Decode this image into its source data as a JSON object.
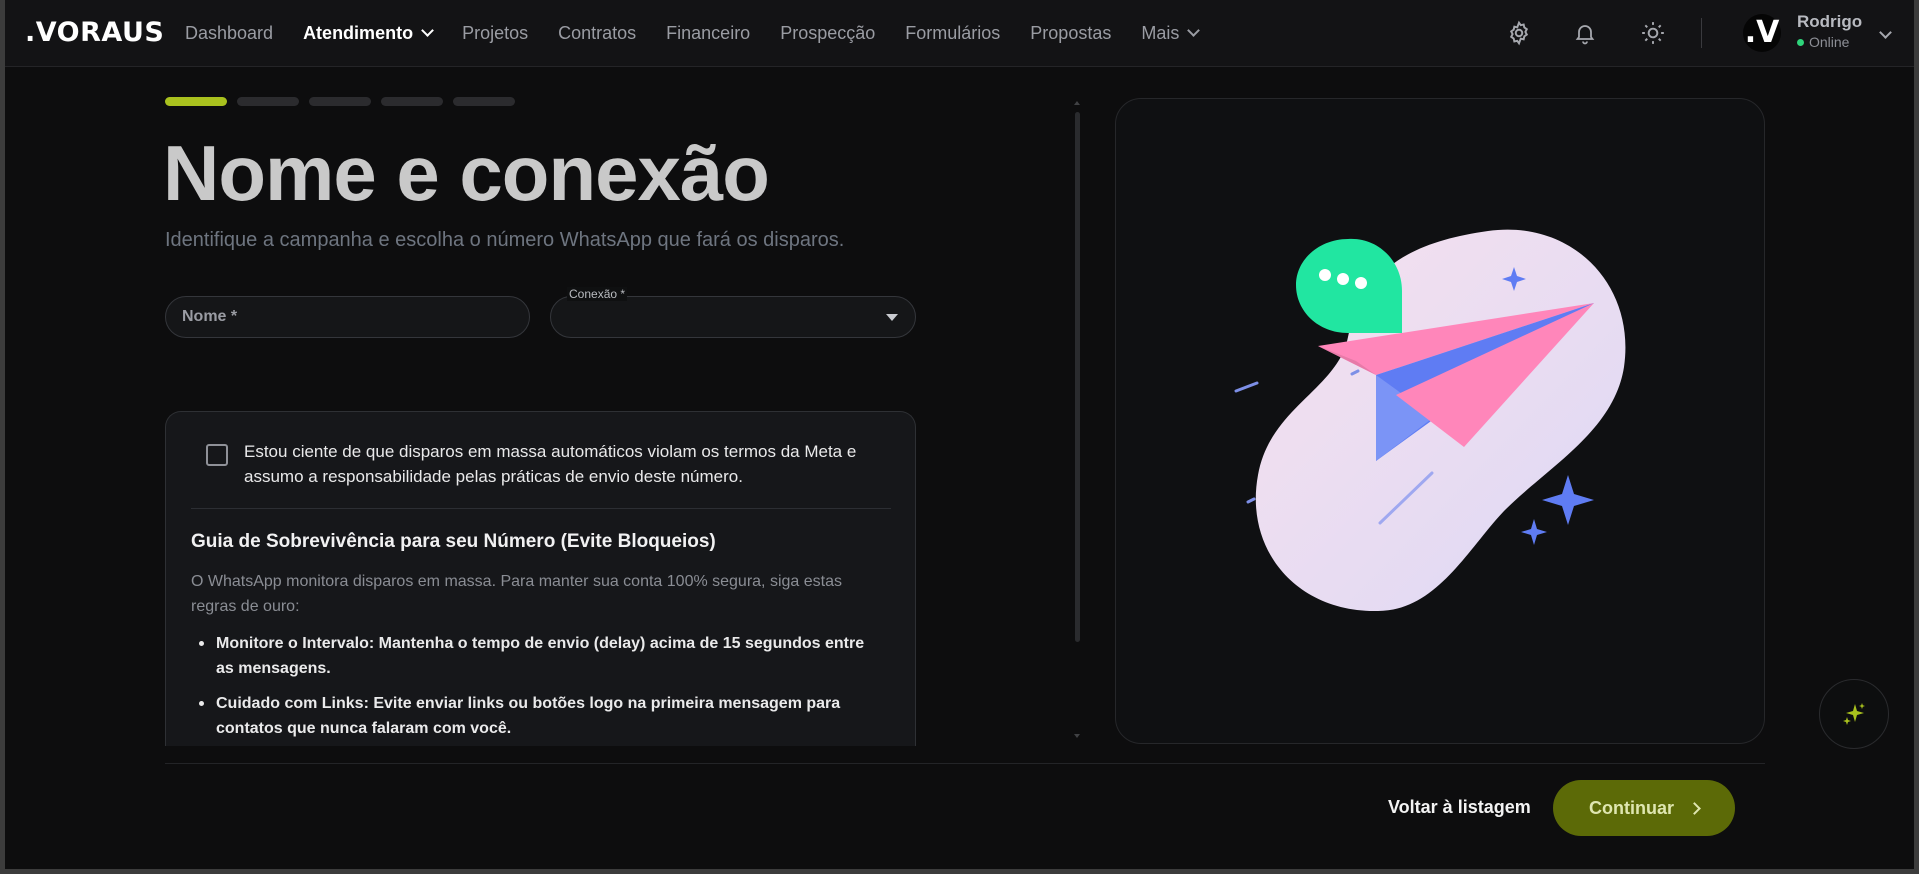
{
  "brand": {
    "logo_text": ".VORAUS"
  },
  "nav": {
    "items": [
      {
        "label": "Dashboard",
        "active": false,
        "has_dropdown": false
      },
      {
        "label": "Atendimento",
        "active": true,
        "has_dropdown": true
      },
      {
        "label": "Projetos",
        "active": false,
        "has_dropdown": false
      },
      {
        "label": "Contratos",
        "active": false,
        "has_dropdown": false
      },
      {
        "label": "Financeiro",
        "active": false,
        "has_dropdown": false
      },
      {
        "label": "Prospecção",
        "active": false,
        "has_dropdown": false
      },
      {
        "label": "Formulários",
        "active": false,
        "has_dropdown": false
      },
      {
        "label": "Propostas",
        "active": false,
        "has_dropdown": false
      },
      {
        "label": "Mais",
        "active": false,
        "has_dropdown": true
      }
    ],
    "icons": [
      "gear-icon",
      "bell-icon",
      "sun-icon"
    ]
  },
  "user": {
    "avatar_text": ".V",
    "name": "Rodrigo",
    "status": "Online",
    "status_color": "#2ed47a"
  },
  "wizard": {
    "total_steps": 5,
    "current_step": 1,
    "accent_color": "#a9c11e",
    "title": "Nome e conexão",
    "subtitle": "Identifique a campanha e escolha o número WhatsApp que fará os disparos."
  },
  "form": {
    "nome": {
      "placeholder": "Nome *",
      "value": ""
    },
    "conexao": {
      "label": "Conexão *",
      "value": ""
    }
  },
  "consent": {
    "checked": false,
    "text": "Estou ciente de que disparos em massa automáticos violam os termos da Meta e assumo a responsabilidade pelas práticas de envio deste número."
  },
  "guide": {
    "title": "Guia de Sobrevivência para seu Número (Evite Bloqueios)",
    "intro": "O WhatsApp monitora disparos em massa. Para manter sua conta 100% segura, siga estas regras de ouro:",
    "rules": [
      "Monitore o Intervalo: Mantenha o tempo de envio (delay) acima de 15 segundos entre as mensagens.",
      "Cuidado com Links: Evite enviar links ou botões logo na primeira mensagem para contatos que nunca falaram com você."
    ]
  },
  "illustration": {
    "icons": [
      "chat-bubble-icon",
      "paper-plane-icon",
      "sparkle-icon"
    ]
  },
  "footer": {
    "back_label": "Voltar à listagem",
    "continue_label": "Continuar",
    "continue_color": "#5c6a07"
  }
}
